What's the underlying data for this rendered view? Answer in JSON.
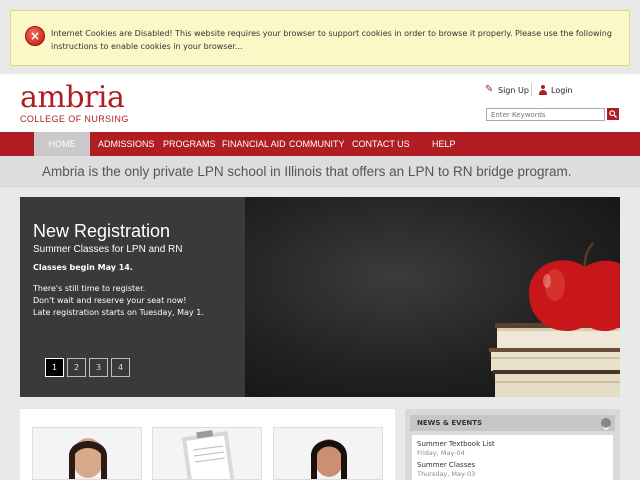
{
  "cookie_warning": {
    "text": "Internet Cookies are Disabled! This website requires your browser to support cookies in order to browse it properly. Please use the following instructions to enable cookies in your browser..."
  },
  "header": {
    "logo_name": "ambria",
    "logo_subtitle": "COLLEGE OF NURSING",
    "signup_label": "Sign Up",
    "login_label": "Login",
    "search_placeholder": "Enter Keywords"
  },
  "nav": {
    "items": [
      {
        "label": "HOME",
        "active": true
      },
      {
        "label": "ADMISSIONS"
      },
      {
        "label": "PROGRAMS"
      },
      {
        "label": "FINANCIAL AID"
      },
      {
        "label": "COMMUNITY"
      },
      {
        "label": "CONTACT US"
      },
      {
        "label": "HELP"
      }
    ]
  },
  "tagline": "Ambria is the only private LPN school in Illinois that offers an LPN to RN bridge program.",
  "slider": {
    "title": "New Registration",
    "subtitle": "Summer Classes for LPN and RN",
    "date_line": "Classes begin May 14.",
    "body": [
      "There's still time to register.",
      "Don't wait and reserve your seat now!",
      "Late registration starts on Tuesday, May 1."
    ],
    "pages": [
      "1",
      "2",
      "3",
      "4"
    ],
    "active_page": "1"
  },
  "news": {
    "title": "NEWS & EVENTS",
    "items": [
      {
        "title": "Summer Textbook List",
        "date": "Friday, May-04"
      },
      {
        "title": "Summer Classes",
        "date": "Thursday, May-03"
      }
    ]
  },
  "colors": {
    "brand_red": "#b01e23",
    "cookie_bg": "#fbf7c6"
  }
}
